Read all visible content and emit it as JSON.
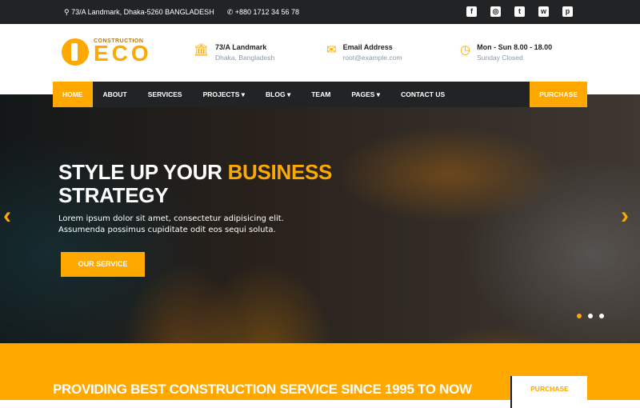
{
  "topbar": {
    "address": "73/A Landmark, Dhaka-5260 BANGLADESH",
    "phone": "+880 1712 34 56 78",
    "social": [
      {
        "icon": "facebook-icon",
        "glyph": "f"
      },
      {
        "icon": "instagram-icon",
        "glyph": "◎"
      },
      {
        "icon": "twitter-icon",
        "glyph": "t"
      },
      {
        "icon": "whatsapp-icon",
        "glyph": "w"
      },
      {
        "icon": "pinterest-icon",
        "glyph": "p"
      }
    ]
  },
  "logo": {
    "sub": "CONSTRUCTION",
    "name": "ECO"
  },
  "header": {
    "location": {
      "title": "73/A Landmark",
      "sub": "Dhaka, Bangladesh"
    },
    "email": {
      "title": "Email Address",
      "sub": "root@example.com"
    },
    "hours": {
      "title": "Mon - Sun 8.00 - 18.00",
      "sub": "Sunday Closed"
    }
  },
  "nav": {
    "items": [
      "HOME",
      "ABOUT",
      "SERVICES",
      "PROJECTS ▾",
      "BLOG ▾",
      "TEAM",
      "PAGES ▾",
      "CONTACT US"
    ],
    "purchase": "PURCHASE"
  },
  "hero": {
    "title_a": "STYLE UP YOUR ",
    "title_hl": "BUSINESS",
    "title_b": "STRATEGY",
    "lead_1": "Lorem ipsum dolor sit amet, consectetur adipisicing elit.",
    "lead_2": "Assumenda possimus cupiditate odit eos sequi soluta.",
    "button": "OUR SERVICE",
    "active_slide": 1,
    "slides": 3
  },
  "band": {
    "text": "PROVIDING BEST CONSTRUCTION SERVICE SINCE 1995 TO NOW",
    "button": "PURCHASE"
  },
  "colors": {
    "accent": "#ffa800",
    "dark": "#222324"
  }
}
